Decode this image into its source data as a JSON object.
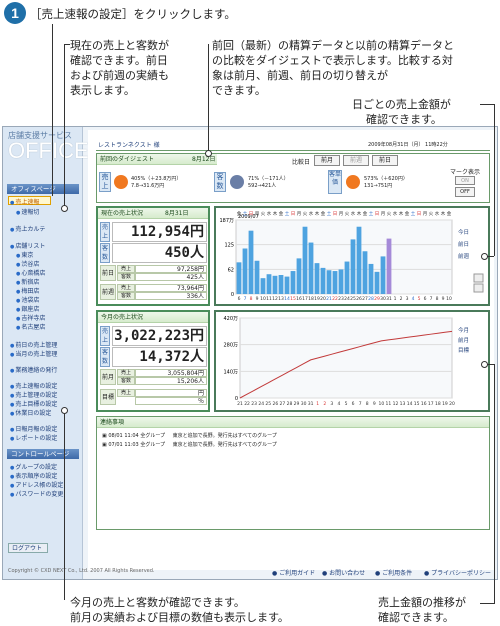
{
  "header": {
    "step": "1",
    "title": "［売上速報の設定］をクリックします。"
  },
  "annotations": {
    "a1": [
      "現在の売上と客数が",
      "確認できます。前日",
      "および前週の実績も",
      "表示します。"
    ],
    "a2": [
      "前回（最新）の精算データと以前の精算データと",
      "の比較をダイジェストで表示します。比較する対",
      "象は前月、前週、前日の切り替えが",
      "できます。"
    ],
    "a3": [
      "日ごとの売上金額が",
      "確認できます。"
    ],
    "a4": [
      "今月の売上と客数が確認できます。",
      "前月の実績および目標の数値も表示します。"
    ],
    "a5": [
      "売上金額の推移が",
      "確認できます。"
    ]
  },
  "app": {
    "brand_small": "店舗支援サービス",
    "brand_big": "OFFICE",
    "store": "レストランネクスト 様",
    "datetime": "2009年08月31日（月） 11時22分",
    "logout": "ログアウト",
    "copyright": "Copyright © CXD NEXT Co., Ltd. 2007 All Rights Reserved.",
    "footer_links": [
      "ご利用ガイド",
      "お問い合わせ",
      "ご利用条件",
      "プライバシーポリシー"
    ]
  },
  "sidebar": {
    "sec1": "オフィスページ",
    "items1": [
      "売上速報",
      "速報切"
    ],
    "items2": [
      "売上カルテ"
    ],
    "items3": [
      "店舗リスト",
      "東京",
      "渋谷店",
      "心斎橋店",
      "新宿店",
      "梅田店",
      "池袋店",
      "銀座店",
      "吉祥寺店",
      "名古屋店"
    ],
    "items4": [
      "前日の売上管理",
      "当月の売上管理"
    ],
    "items5": [
      "業務連絡の発行"
    ],
    "items6": [
      "売上速報の設定",
      "売上管理の設定",
      "売上目標の設定",
      "休業日の設定"
    ],
    "items7": [
      "日報月報の設定",
      "レポートの設定"
    ],
    "sec2": "コントロールページ",
    "items8": [
      "グループの設定",
      "表示順序の設定",
      "アドレス帳の設定",
      "パスワードの変更"
    ]
  },
  "digest": {
    "title": "前回のダイジェスト",
    "date": "8月12日",
    "compare_label": "比較日",
    "tabs": [
      "前月",
      "前週",
      "前日"
    ],
    "uriage_label": "売上",
    "uriage_l1": "405%（＋23.8万円）",
    "uriage_l2": "7.8→31.6万円",
    "kyaku_label": "客数",
    "kyaku_l1": "71%（－171人）",
    "kyaku_l2": "592→421人",
    "tanka_label": "客単価",
    "tanka_l1": "573%（＋620円）",
    "tanka_l2": "131→751円",
    "mark_label": "マーク表示",
    "on": "ON",
    "off": "OFF"
  },
  "current": {
    "title": "現在の売上状況",
    "date": "8月31日",
    "sales": "112,954円",
    "customers": "450人",
    "uriage": "売上",
    "kyaku": "客数",
    "prev_day": "前日",
    "prev_week": "前週",
    "pd_sales": "97,258円",
    "pd_cust": "425人",
    "pw_sales": "73,964円",
    "pw_cust": "336人"
  },
  "monthly": {
    "title": "今月の売上状況",
    "sales": "3,022,223円",
    "customers": "14,372人",
    "prev_month": "前月",
    "target": "目標",
    "uriage": "売上",
    "kyaku": "客数",
    "pm_sales": "3,055,804円",
    "pm_cust": "15,206人",
    "t_sales": "円",
    "t_cust": "％"
  },
  "chart_data": [
    {
      "type": "bar",
      "title": "",
      "month_label": "2009/07",
      "ylim": [
        0,
        187
      ],
      "yticks": [
        "187万",
        "125",
        "62",
        "0"
      ],
      "legend": [
        "今日",
        "前日",
        "前週"
      ],
      "weekdays": [
        "金",
        "土",
        "日",
        "月",
        "火",
        "水",
        "木",
        "金",
        "土",
        "日",
        "月",
        "火",
        "水",
        "木",
        "金",
        "土",
        "日",
        "月",
        "火",
        "水",
        "木",
        "金",
        "土",
        "日",
        "月",
        "火",
        "水",
        "木",
        "金",
        "土",
        "日",
        "月",
        "火",
        "水",
        "木",
        "金"
      ],
      "x": [
        "6",
        "7",
        "8",
        "9",
        "10",
        "11",
        "12",
        "13",
        "14",
        "15",
        "16",
        "17",
        "18",
        "19",
        "20",
        "21",
        "22",
        "23",
        "24",
        "25",
        "26",
        "27",
        "28",
        "29",
        "30",
        "31",
        "1",
        "2",
        "3",
        "4",
        "5",
        "6",
        "7",
        "8",
        "9",
        "10"
      ],
      "values": [
        80,
        115,
        160,
        84,
        40,
        50,
        46,
        48,
        44,
        58,
        90,
        170,
        130,
        78,
        66,
        60,
        58,
        62,
        82,
        138,
        170,
        108,
        76,
        56,
        95,
        140,
        0,
        0,
        0,
        0,
        0,
        0,
        0,
        0,
        0,
        0
      ],
      "highlight": {
        "25": "#a58ad8",
        "26": "#3fae6c"
      }
    },
    {
      "type": "line",
      "title": "",
      "ylim": [
        0,
        420
      ],
      "yticks": [
        "420万",
        "280万",
        "140万",
        "0"
      ],
      "legend": [
        "今月",
        "前月",
        "目標"
      ],
      "x": [
        "21",
        "22",
        "23",
        "24",
        "25",
        "26",
        "27",
        "28",
        "29",
        "30",
        "31",
        "1",
        "2",
        "3",
        "4",
        "5",
        "6",
        "7",
        "8",
        "9",
        "10",
        "11",
        "12",
        "13",
        "14",
        "15",
        "16",
        "17",
        "18",
        "19",
        "20"
      ],
      "series": [
        {
          "name": "",
          "values": [
            0,
            20,
            40,
            60,
            80,
            100,
            120,
            140,
            160,
            180,
            200,
            210,
            220,
            230,
            240,
            250,
            260,
            270,
            280,
            290,
            300,
            305,
            310,
            315,
            320,
            325,
            330,
            335,
            340,
            345,
            350
          ]
        }
      ]
    }
  ],
  "news": {
    "title": "連絡事項",
    "rows": [
      [
        "08/01 11:04",
        "全グループ",
        "東京と追加で長野。発行先はすべてのグループ"
      ],
      [
        "07/01 11:03",
        "全グループ",
        "東京と追加で長野。発行先はすべてのグループ"
      ]
    ]
  }
}
